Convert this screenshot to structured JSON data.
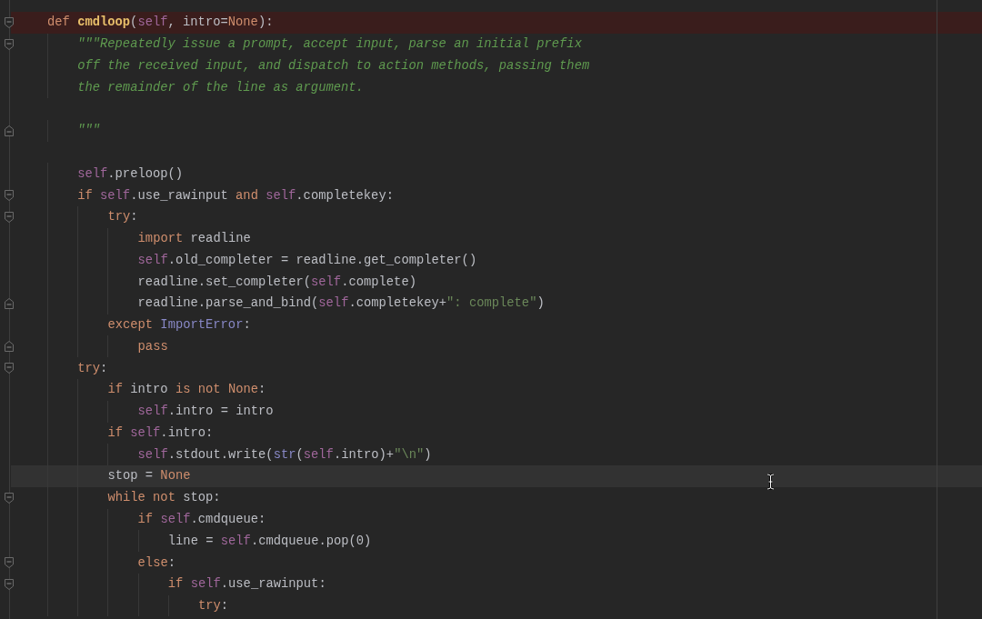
{
  "editor": {
    "lines": [
      {
        "kind": "code",
        "fold_start": true,
        "fold_end": false,
        "highlighted": true,
        "current": false,
        "tokens": [
          {
            "kind": "keyword",
            "text": "def "
          },
          {
            "kind": "function",
            "text": "cmdloop"
          },
          {
            "kind": "plain",
            "text": "("
          },
          {
            "kind": "self",
            "text": "self"
          },
          {
            "kind": "plain",
            "text": ", intro="
          },
          {
            "kind": "keyword",
            "text": "None"
          },
          {
            "kind": "plain",
            "text": "):"
          }
        ],
        "children": [
          {
            "kind": "code",
            "fold_start": true,
            "fold_end": false,
            "highlighted": false,
            "current": false,
            "tokens": [
              {
                "kind": "docstring",
                "text": "\"\"\"Repeatedly issue a prompt, accept input, parse an initial prefix"
              }
            ]
          },
          {
            "kind": "code",
            "fold_start": false,
            "fold_end": false,
            "highlighted": false,
            "current": false,
            "tokens": [
              {
                "kind": "docstring",
                "text": "off the received input, and dispatch to action methods, passing them"
              }
            ]
          },
          {
            "kind": "code",
            "fold_start": false,
            "fold_end": false,
            "highlighted": false,
            "current": false,
            "tokens": [
              {
                "kind": "docstring",
                "text": "the remainder of the line as argument."
              }
            ]
          },
          {
            "kind": "blank"
          },
          {
            "kind": "code",
            "fold_start": false,
            "fold_end": true,
            "highlighted": false,
            "current": false,
            "tokens": [
              {
                "kind": "docstring",
                "text": "\"\"\""
              }
            ]
          },
          {
            "kind": "blank"
          },
          {
            "kind": "code",
            "fold_start": false,
            "fold_end": false,
            "highlighted": false,
            "current": false,
            "tokens": [
              {
                "kind": "self",
                "text": "self"
              },
              {
                "kind": "plain",
                "text": ".preloop()"
              }
            ]
          },
          {
            "kind": "code",
            "fold_start": true,
            "fold_end": false,
            "highlighted": false,
            "current": false,
            "tokens": [
              {
                "kind": "keyword",
                "text": "if "
              },
              {
                "kind": "self",
                "text": "self"
              },
              {
                "kind": "plain",
                "text": ".use_rawinput "
              },
              {
                "kind": "keyword",
                "text": "and "
              },
              {
                "kind": "self",
                "text": "self"
              },
              {
                "kind": "plain",
                "text": ".completekey:"
              }
            ],
            "children": [
              {
                "kind": "code",
                "fold_start": true,
                "fold_end": false,
                "highlighted": false,
                "current": false,
                "tokens": [
                  {
                    "kind": "keyword",
                    "text": "try"
                  },
                  {
                    "kind": "plain",
                    "text": ":"
                  }
                ],
                "children": [
                  {
                    "kind": "code",
                    "fold_start": false,
                    "fold_end": false,
                    "highlighted": false,
                    "current": false,
                    "tokens": [
                      {
                        "kind": "keyword",
                        "text": "import "
                      },
                      {
                        "kind": "plain",
                        "text": "readline"
                      }
                    ]
                  },
                  {
                    "kind": "code",
                    "fold_start": false,
                    "fold_end": false,
                    "highlighted": false,
                    "current": false,
                    "tokens": [
                      {
                        "kind": "self",
                        "text": "self"
                      },
                      {
                        "kind": "plain",
                        "text": ".old_completer = readline.get_completer()"
                      }
                    ]
                  },
                  {
                    "kind": "code",
                    "fold_start": false,
                    "fold_end": false,
                    "highlighted": false,
                    "current": false,
                    "tokens": [
                      {
                        "kind": "plain",
                        "text": "readline.set_completer("
                      },
                      {
                        "kind": "self",
                        "text": "self"
                      },
                      {
                        "kind": "plain",
                        "text": ".complete)"
                      }
                    ]
                  },
                  {
                    "kind": "code",
                    "fold_start": false,
                    "fold_end": true,
                    "highlighted": false,
                    "current": false,
                    "tokens": [
                      {
                        "kind": "plain",
                        "text": "readline.parse_and_bind("
                      },
                      {
                        "kind": "self",
                        "text": "self"
                      },
                      {
                        "kind": "plain",
                        "text": ".completekey+"
                      },
                      {
                        "kind": "string",
                        "text": "\": complete\""
                      },
                      {
                        "kind": "plain",
                        "text": ")"
                      }
                    ]
                  }
                ]
              },
              {
                "kind": "code",
                "fold_start": false,
                "fold_end": false,
                "highlighted": false,
                "current": false,
                "tokens": [
                  {
                    "kind": "keyword",
                    "text": "except "
                  },
                  {
                    "kind": "builtin",
                    "text": "ImportError"
                  },
                  {
                    "kind": "plain",
                    "text": ":"
                  }
                ],
                "children": [
                  {
                    "kind": "code",
                    "fold_start": false,
                    "fold_end": true,
                    "highlighted": false,
                    "current": false,
                    "tokens": [
                      {
                        "kind": "keyword",
                        "text": "pass"
                      }
                    ]
                  }
                ]
              }
            ]
          },
          {
            "kind": "code",
            "fold_start": true,
            "fold_end": false,
            "highlighted": false,
            "current": false,
            "tokens": [
              {
                "kind": "keyword",
                "text": "try"
              },
              {
                "kind": "plain",
                "text": ":"
              }
            ],
            "children": [
              {
                "kind": "code",
                "fold_start": false,
                "fold_end": false,
                "highlighted": false,
                "current": false,
                "tokens": [
                  {
                    "kind": "keyword",
                    "text": "if "
                  },
                  {
                    "kind": "plain",
                    "text": "intro "
                  },
                  {
                    "kind": "keyword",
                    "text": "is not None"
                  },
                  {
                    "kind": "plain",
                    "text": ":"
                  }
                ],
                "children": [
                  {
                    "kind": "code",
                    "fold_start": false,
                    "fold_end": false,
                    "highlighted": false,
                    "current": false,
                    "tokens": [
                      {
                        "kind": "self",
                        "text": "self"
                      },
                      {
                        "kind": "plain",
                        "text": ".intro = intro"
                      }
                    ]
                  }
                ]
              },
              {
                "kind": "code",
                "fold_start": false,
                "fold_end": false,
                "highlighted": false,
                "current": false,
                "tokens": [
                  {
                    "kind": "keyword",
                    "text": "if "
                  },
                  {
                    "kind": "self",
                    "text": "self"
                  },
                  {
                    "kind": "plain",
                    "text": ".intro:"
                  }
                ],
                "children": [
                  {
                    "kind": "code",
                    "fold_start": false,
                    "fold_end": false,
                    "highlighted": false,
                    "current": false,
                    "tokens": [
                      {
                        "kind": "self",
                        "text": "self"
                      },
                      {
                        "kind": "plain",
                        "text": ".stdout.write("
                      },
                      {
                        "kind": "builtin",
                        "text": "str"
                      },
                      {
                        "kind": "plain",
                        "text": "("
                      },
                      {
                        "kind": "self",
                        "text": "self"
                      },
                      {
                        "kind": "plain",
                        "text": ".intro)+"
                      },
                      {
                        "kind": "string",
                        "text": "\"\\n\""
                      },
                      {
                        "kind": "plain",
                        "text": ")"
                      }
                    ]
                  }
                ]
              },
              {
                "kind": "code",
                "fold_start": false,
                "fold_end": false,
                "highlighted": false,
                "current": true,
                "tokens": [
                  {
                    "kind": "plain",
                    "text": "stop = "
                  },
                  {
                    "kind": "keyword",
                    "text": "None"
                  }
                ]
              },
              {
                "kind": "code",
                "fold_start": true,
                "fold_end": false,
                "highlighted": false,
                "current": false,
                "tokens": [
                  {
                    "kind": "keyword",
                    "text": "while not "
                  },
                  {
                    "kind": "plain",
                    "text": "stop:"
                  }
                ],
                "children": [
                  {
                    "kind": "code",
                    "fold_start": false,
                    "fold_end": false,
                    "highlighted": false,
                    "current": false,
                    "tokens": [
                      {
                        "kind": "keyword",
                        "text": "if "
                      },
                      {
                        "kind": "self",
                        "text": "self"
                      },
                      {
                        "kind": "plain",
                        "text": ".cmdqueue:"
                      }
                    ],
                    "children": [
                      {
                        "kind": "code",
                        "fold_start": false,
                        "fold_end": false,
                        "highlighted": false,
                        "current": false,
                        "tokens": [
                          {
                            "kind": "plain",
                            "text": "line = "
                          },
                          {
                            "kind": "self",
                            "text": "self"
                          },
                          {
                            "kind": "plain",
                            "text": ".cmdqueue.pop("
                          },
                          {
                            "kind": "number",
                            "text": "0"
                          },
                          {
                            "kind": "plain",
                            "text": ")"
                          }
                        ]
                      }
                    ]
                  },
                  {
                    "kind": "code",
                    "fold_start": true,
                    "fold_end": false,
                    "highlighted": false,
                    "current": false,
                    "tokens": [
                      {
                        "kind": "keyword",
                        "text": "else"
                      },
                      {
                        "kind": "plain",
                        "text": ":"
                      }
                    ],
                    "children": [
                      {
                        "kind": "code",
                        "fold_start": true,
                        "fold_end": false,
                        "highlighted": false,
                        "current": false,
                        "tokens": [
                          {
                            "kind": "keyword",
                            "text": "if "
                          },
                          {
                            "kind": "self",
                            "text": "self"
                          },
                          {
                            "kind": "plain",
                            "text": ".use_rawinput:"
                          }
                        ],
                        "children": [
                          {
                            "kind": "code",
                            "fold_start": false,
                            "fold_end": false,
                            "highlighted": false,
                            "current": false,
                            "tokens": [
                              {
                                "kind": "keyword",
                                "text": "try"
                              },
                              {
                                "kind": "plain",
                                "text": ":"
                              }
                            ]
                          }
                        ]
                      }
                    ]
                  }
                ]
              }
            ]
          }
        ]
      }
    ]
  }
}
